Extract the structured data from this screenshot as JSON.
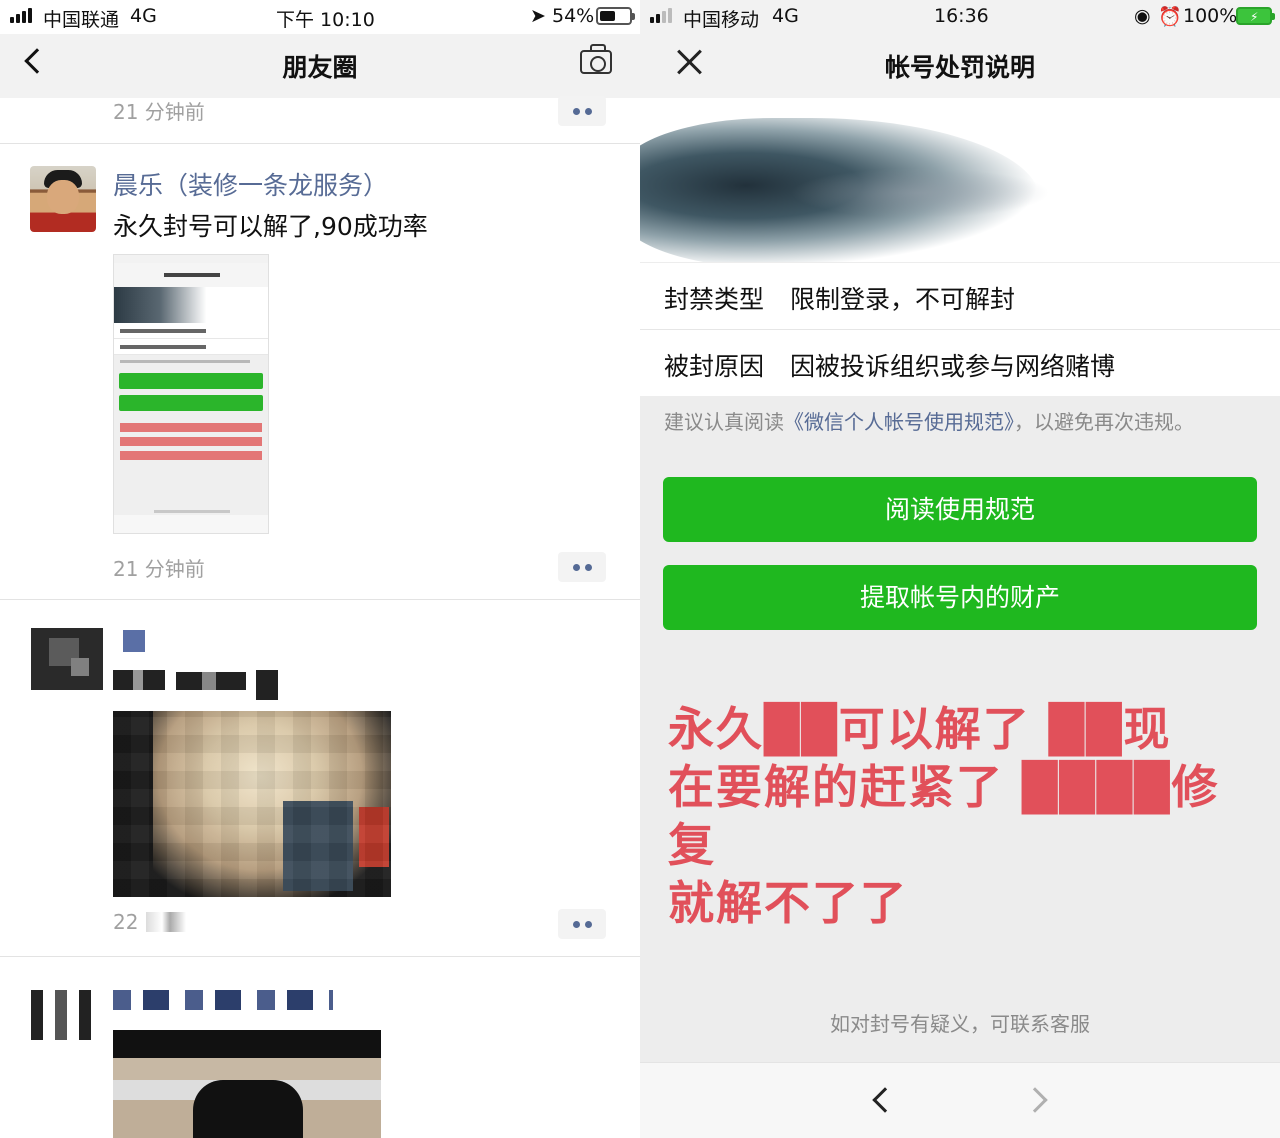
{
  "left_phone": {
    "status": {
      "carrier": "中国联通",
      "network": "4G",
      "time": "下午 10:10",
      "battery_percent": "54%",
      "battery_level": 0.54
    },
    "nav": {
      "title": "朋友圈"
    },
    "feed": {
      "prev_post_time": "21 分钟前",
      "post": {
        "author": "晨乐（装修一条龙服务）",
        "text": "永久封号可以解了,90成功率",
        "time": "21 分钟前"
      },
      "post2_time_partial": "22"
    }
  },
  "right_phone": {
    "status": {
      "carrier": "中国移动",
      "network": "4G",
      "time": "16:36",
      "battery_percent": "100%",
      "battery_level": 1.0
    },
    "nav": {
      "title": "帐号处罚说明"
    },
    "ban_type": {
      "label": "封禁类型",
      "value": "限制登录，不可解封"
    },
    "ban_reason": {
      "label": "被封原因",
      "value": "因被投诉组织或参与网络赌博"
    },
    "advice": {
      "prefix": "建议认真阅读",
      "link": "《微信个人帐号使用规范》",
      "suffix": "，以避免再次违规。"
    },
    "buttons": {
      "read_rules": "阅读使用规范",
      "withdraw_assets": "提取帐号内的财产"
    },
    "overlay_text": {
      "line1": "永久██可以解了 ██现",
      "line2": "在要解的赶紧了 ████修复",
      "line3": "就解不了了"
    },
    "contact_text": "如对封号有疑义，可联系客服"
  },
  "colors": {
    "link_blue": "#576b95",
    "button_green": "#1fb81f",
    "overlay_red": "#e1505a"
  }
}
